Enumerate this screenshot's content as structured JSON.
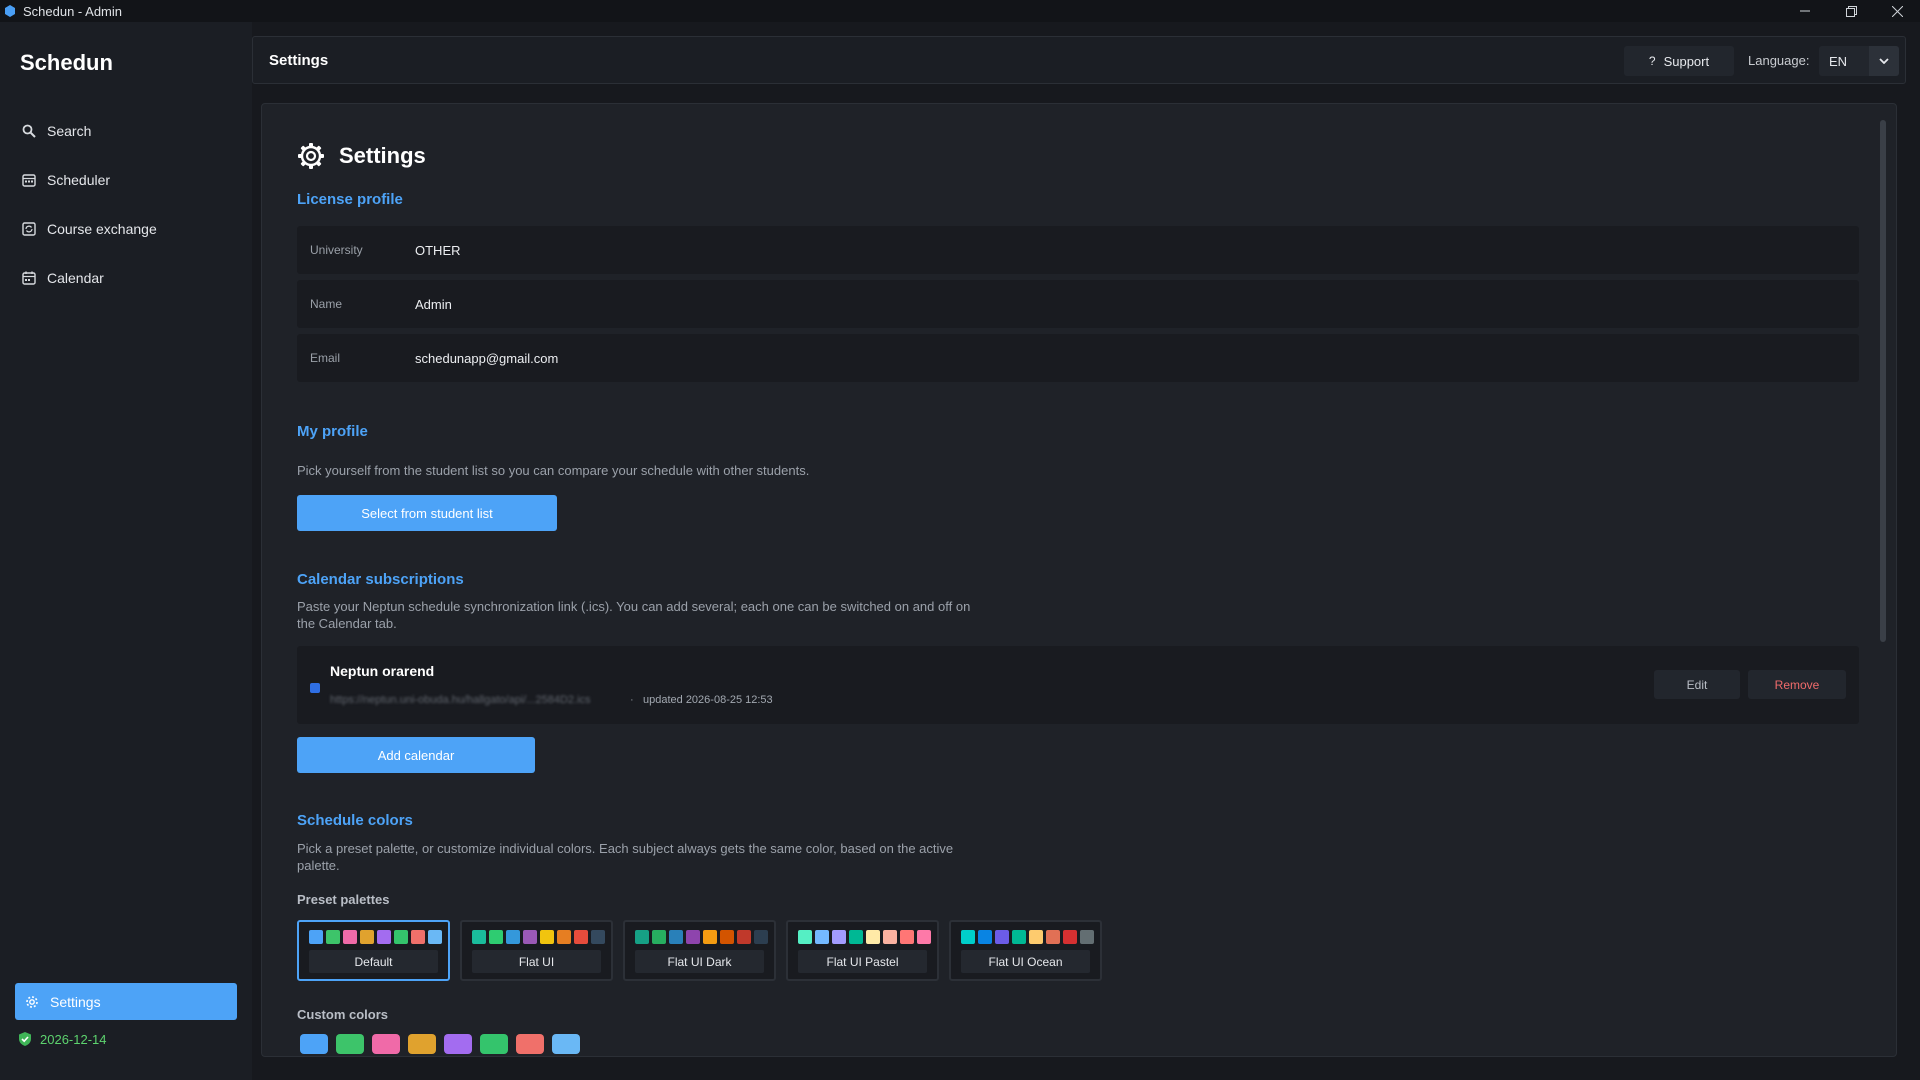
{
  "window": {
    "title": "Schedun - Admin"
  },
  "sidebar": {
    "brand": "Schedun",
    "items": [
      {
        "label": "Search",
        "icon": "search-icon"
      },
      {
        "label": "Scheduler",
        "icon": "calendar-grid-icon"
      },
      {
        "label": "Course exchange",
        "icon": "exchange-icon"
      },
      {
        "label": "Calendar",
        "icon": "calendar-icon"
      }
    ],
    "settings_label": "Settings",
    "license_date": "2026-12-14"
  },
  "header": {
    "title": "Settings",
    "support_label": "Support",
    "language_label": "Language:",
    "language_value": "EN"
  },
  "main": {
    "title": "Settings",
    "license_profile": {
      "title": "License profile",
      "fields": [
        {
          "label": "University",
          "value": "OTHER"
        },
        {
          "label": "Name",
          "value": "Admin"
        },
        {
          "label": "Email",
          "value": "schedunapp@gmail.com"
        }
      ]
    },
    "my_profile": {
      "title": "My profile",
      "description": "Pick yourself from the student list so you can compare your schedule with other students.",
      "button": "Select from student list"
    },
    "calendar_subscriptions": {
      "title": "Calendar subscriptions",
      "description": "Paste your Neptun schedule synchronization link (.ics). You can add several; each one can be switched on and off on the Calendar tab.",
      "item": {
        "name": "Neptun orarend",
        "url": "https://neptun.uni-obuda.hu/hallgato/api/...2584D2.ics",
        "separator": "·",
        "updated": "updated 2026-08-25 12:53",
        "edit": "Edit",
        "remove": "Remove"
      },
      "add_button": "Add calendar"
    },
    "schedule_colors": {
      "title": "Schedule colors",
      "description": "Pick a preset palette, or customize individual colors. Each subject always gets the same color, based on the active palette.",
      "preset_label": "Preset palettes",
      "palettes": [
        {
          "name": "Default",
          "active": true,
          "colors": [
            "#4da3f7",
            "#3dc46a",
            "#f06aa8",
            "#e0a22e",
            "#a36cf0",
            "#34c46c",
            "#f0706a",
            "#6ab8f5"
          ]
        },
        {
          "name": "Flat UI",
          "active": false,
          "colors": [
            "#1abc9c",
            "#2ecc71",
            "#3498db",
            "#9b59b6",
            "#f1c40f",
            "#e67e22",
            "#e74c3c",
            "#34495e"
          ]
        },
        {
          "name": "Flat UI Dark",
          "active": false,
          "colors": [
            "#16a085",
            "#27ae60",
            "#2980b9",
            "#8e44ad",
            "#f39c12",
            "#d35400",
            "#c0392b",
            "#2c3e50"
          ]
        },
        {
          "name": "Flat UI Pastel",
          "active": false,
          "colors": [
            "#55efc4",
            "#74b9ff",
            "#a29bfe",
            "#00b894",
            "#ffeaa7",
            "#fab1a0",
            "#ff7675",
            "#fd79a8"
          ]
        },
        {
          "name": "Flat UI Ocean",
          "active": false,
          "colors": [
            "#00cec9",
            "#0984e3",
            "#6c5ce7",
            "#00b894",
            "#fdcb6e",
            "#e17055",
            "#d63031",
            "#636e72"
          ]
        }
      ],
      "custom_label": "Custom colors",
      "custom_colors": [
        "#4da3f7",
        "#3dc46a",
        "#f06aa8",
        "#e0a22e",
        "#a36cf0",
        "#34c46c",
        "#f0706a",
        "#6ab8f5"
      ]
    }
  }
}
